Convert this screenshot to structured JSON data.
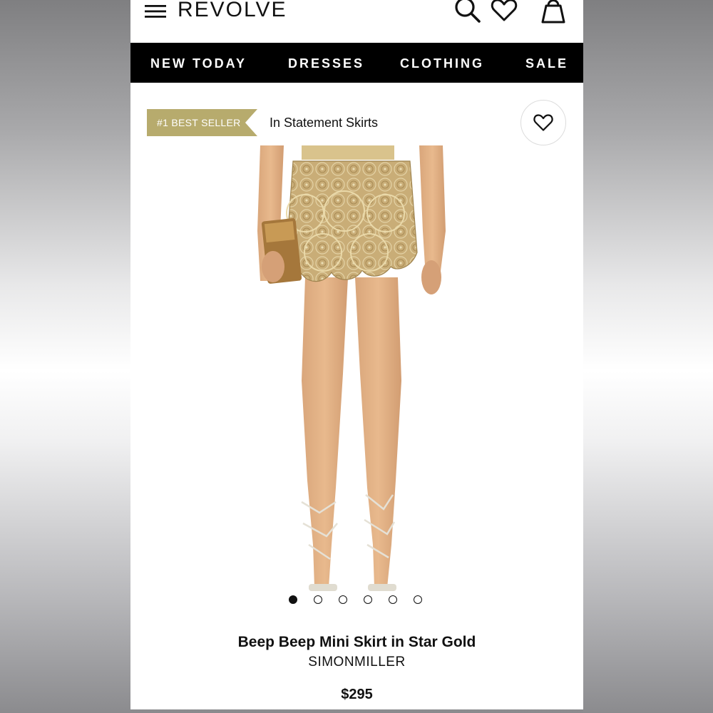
{
  "header": {
    "brand": "REVOLVE",
    "icons": [
      "menu-icon",
      "search-icon",
      "heart-icon",
      "bag-icon"
    ]
  },
  "nav": {
    "items": [
      {
        "label": "NEW TODAY"
      },
      {
        "label": "DRESSES"
      },
      {
        "label": "CLOTHING"
      },
      {
        "label": "SALE"
      }
    ]
  },
  "badge": {
    "label": "#1 BEST SELLER",
    "color": "#b7ab6d"
  },
  "category": {
    "label": "In Statement Skirts"
  },
  "gallery": {
    "dot_count": 6,
    "active_index": 0
  },
  "product": {
    "title": "Beep Beep Mini Skirt in Star Gold",
    "brand": "SIMONMILLER",
    "price": "$295"
  }
}
